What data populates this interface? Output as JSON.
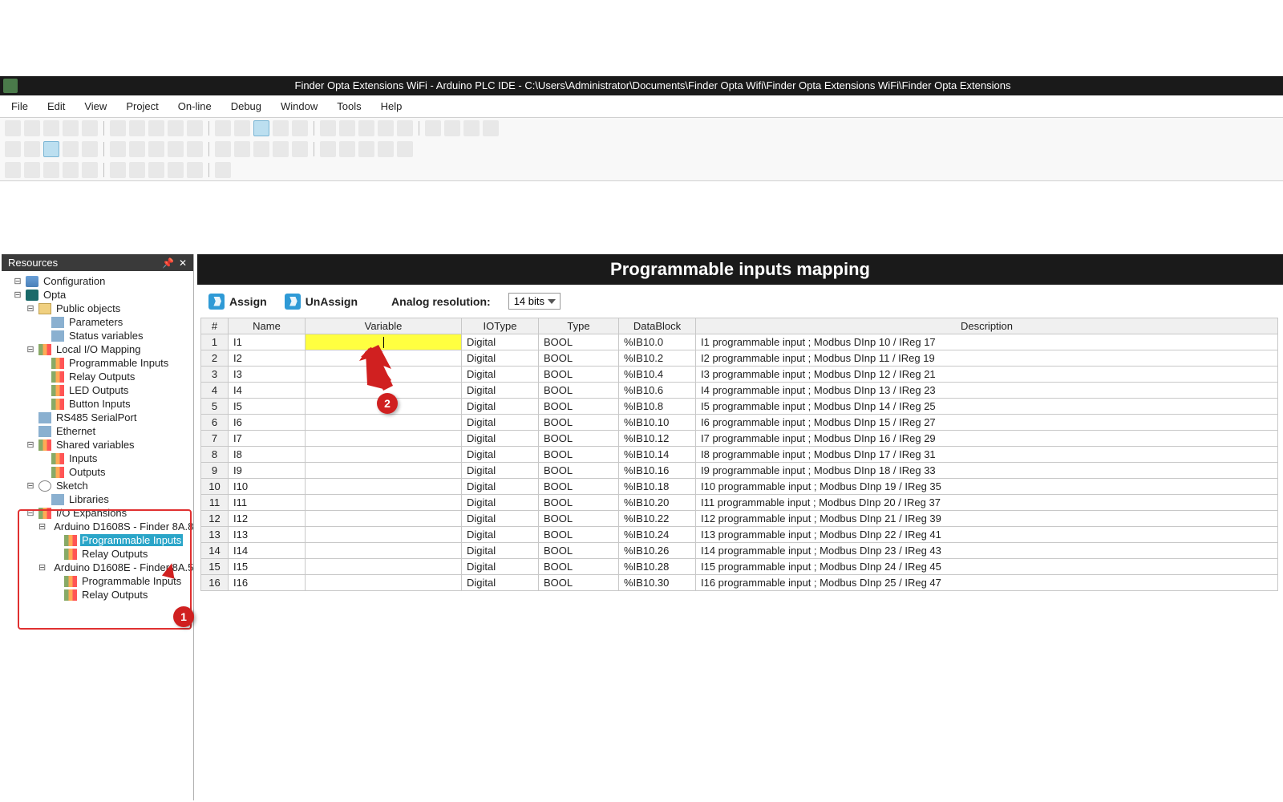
{
  "title": "Finder Opta Extensions WiFi - Arduino PLC IDE - C:\\Users\\Administrator\\Documents\\Finder Opta Wifi\\Finder Opta Extensions WiFi\\Finder Opta Extensions",
  "menu": [
    "File",
    "Edit",
    "View",
    "Project",
    "On-line",
    "Debug",
    "Window",
    "Tools",
    "Help"
  ],
  "resources": {
    "panel_title": "Resources",
    "items": [
      {
        "lvl": 1,
        "exp": "-",
        "ico": "ico-cfg",
        "label": "Configuration"
      },
      {
        "lvl": 1,
        "exp": "-",
        "ico": "ico-opta",
        "label": "Opta"
      },
      {
        "lvl": 2,
        "exp": "-",
        "ico": "ico-folder",
        "label": "Public objects"
      },
      {
        "lvl": 3,
        "exp": "",
        "ico": "ico-node",
        "label": "Parameters"
      },
      {
        "lvl": 3,
        "exp": "",
        "ico": "ico-node",
        "label": "Status variables"
      },
      {
        "lvl": 2,
        "exp": "-",
        "ico": "ico-io",
        "label": "Local I/O Mapping"
      },
      {
        "lvl": 3,
        "exp": "",
        "ico": "ico-io",
        "label": "Programmable Inputs"
      },
      {
        "lvl": 3,
        "exp": "",
        "ico": "ico-io",
        "label": "Relay Outputs"
      },
      {
        "lvl": 3,
        "exp": "",
        "ico": "ico-io",
        "label": "LED Outputs"
      },
      {
        "lvl": 3,
        "exp": "",
        "ico": "ico-io",
        "label": "Button Inputs"
      },
      {
        "lvl": 2,
        "exp": "",
        "ico": "ico-node",
        "label": "RS485 SerialPort"
      },
      {
        "lvl": 2,
        "exp": "",
        "ico": "ico-node",
        "label": "Ethernet"
      },
      {
        "lvl": 2,
        "exp": "-",
        "ico": "ico-io",
        "label": "Shared variables"
      },
      {
        "lvl": 3,
        "exp": "",
        "ico": "ico-io",
        "label": "Inputs"
      },
      {
        "lvl": 3,
        "exp": "",
        "ico": "ico-io",
        "label": "Outputs"
      },
      {
        "lvl": 2,
        "exp": "-",
        "ico": "ico-sketch",
        "label": "Sketch"
      },
      {
        "lvl": 3,
        "exp": "",
        "ico": "ico-node",
        "label": "Libraries"
      },
      {
        "lvl": 2,
        "exp": "-",
        "ico": "ico-io",
        "label": "I/O Expansions"
      },
      {
        "lvl": 3,
        "exp": "-",
        "ico": "ico-chip",
        "label": "Arduino D1608S - Finder 8A.8"
      },
      {
        "lvl": 4,
        "exp": "",
        "ico": "ico-io",
        "label": "Programmable Inputs",
        "selected": true
      },
      {
        "lvl": 4,
        "exp": "",
        "ico": "ico-io",
        "label": "Relay Outputs"
      },
      {
        "lvl": 3,
        "exp": "-",
        "ico": "ico-chip",
        "label": "Arduino D1608E - Finder 8A.5"
      },
      {
        "lvl": 4,
        "exp": "",
        "ico": "ico-io",
        "label": "Programmable Inputs"
      },
      {
        "lvl": 4,
        "exp": "",
        "ico": "ico-io",
        "label": "Relay Outputs"
      }
    ]
  },
  "content": {
    "title": "Programmable inputs mapping",
    "assign": "Assign",
    "unassign": "UnAssign",
    "res_label": "Analog resolution:",
    "res_value": "14 bits",
    "columns": [
      "#",
      "Name",
      "Variable",
      "IOType",
      "Type",
      "DataBlock",
      "Description"
    ],
    "rows": [
      {
        "n": 1,
        "name": "I1",
        "var": "",
        "iotype": "Digital",
        "type": "BOOL",
        "db": "%IB10.0",
        "desc": "I1 programmable input ; Modbus DInp 10 / IReg 17",
        "editing": true
      },
      {
        "n": 2,
        "name": "I2",
        "var": "",
        "iotype": "Digital",
        "type": "BOOL",
        "db": "%IB10.2",
        "desc": "I2 programmable input ; Modbus DInp 11 / IReg 19"
      },
      {
        "n": 3,
        "name": "I3",
        "var": "",
        "iotype": "Digital",
        "type": "BOOL",
        "db": "%IB10.4",
        "desc": "I3 programmable input ; Modbus DInp 12 / IReg 21"
      },
      {
        "n": 4,
        "name": "I4",
        "var": "",
        "iotype": "Digital",
        "type": "BOOL",
        "db": "%IB10.6",
        "desc": "I4 programmable input ; Modbus DInp 13 / IReg 23"
      },
      {
        "n": 5,
        "name": "I5",
        "var": "",
        "iotype": "Digital",
        "type": "BOOL",
        "db": "%IB10.8",
        "desc": "I5 programmable input ; Modbus DInp 14 / IReg 25"
      },
      {
        "n": 6,
        "name": "I6",
        "var": "",
        "iotype": "Digital",
        "type": "BOOL",
        "db": "%IB10.10",
        "desc": "I6 programmable input ; Modbus DInp 15 / IReg 27"
      },
      {
        "n": 7,
        "name": "I7",
        "var": "",
        "iotype": "Digital",
        "type": "BOOL",
        "db": "%IB10.12",
        "desc": "I7 programmable input ; Modbus DInp 16 / IReg 29"
      },
      {
        "n": 8,
        "name": "I8",
        "var": "",
        "iotype": "Digital",
        "type": "BOOL",
        "db": "%IB10.14",
        "desc": "I8 programmable input ; Modbus DInp 17 / IReg 31"
      },
      {
        "n": 9,
        "name": "I9",
        "var": "",
        "iotype": "Digital",
        "type": "BOOL",
        "db": "%IB10.16",
        "desc": "I9 programmable input ; Modbus DInp 18 / IReg 33"
      },
      {
        "n": 10,
        "name": "I10",
        "var": "",
        "iotype": "Digital",
        "type": "BOOL",
        "db": "%IB10.18",
        "desc": "I10 programmable input ; Modbus DInp 19 / IReg 35"
      },
      {
        "n": 11,
        "name": "I11",
        "var": "",
        "iotype": "Digital",
        "type": "BOOL",
        "db": "%IB10.20",
        "desc": "I11 programmable input ; Modbus DInp 20 / IReg 37"
      },
      {
        "n": 12,
        "name": "I12",
        "var": "",
        "iotype": "Digital",
        "type": "BOOL",
        "db": "%IB10.22",
        "desc": "I12 programmable input ; Modbus DInp 21 / IReg 39"
      },
      {
        "n": 13,
        "name": "I13",
        "var": "",
        "iotype": "Digital",
        "type": "BOOL",
        "db": "%IB10.24",
        "desc": "I13 programmable input ; Modbus DInp 22 / IReg 41"
      },
      {
        "n": 14,
        "name": "I14",
        "var": "",
        "iotype": "Digital",
        "type": "BOOL",
        "db": "%IB10.26",
        "desc": "I14 programmable input ; Modbus DInp 23 / IReg 43"
      },
      {
        "n": 15,
        "name": "I15",
        "var": "",
        "iotype": "Digital",
        "type": "BOOL",
        "db": "%IB10.28",
        "desc": "I15 programmable input ; Modbus DInp 24 / IReg 45"
      },
      {
        "n": 16,
        "name": "I16",
        "var": "",
        "iotype": "Digital",
        "type": "BOOL",
        "db": "%IB10.30",
        "desc": "I16 programmable input ; Modbus DInp 25 / IReg 47"
      }
    ]
  },
  "callouts": {
    "one": "1",
    "two": "2"
  }
}
